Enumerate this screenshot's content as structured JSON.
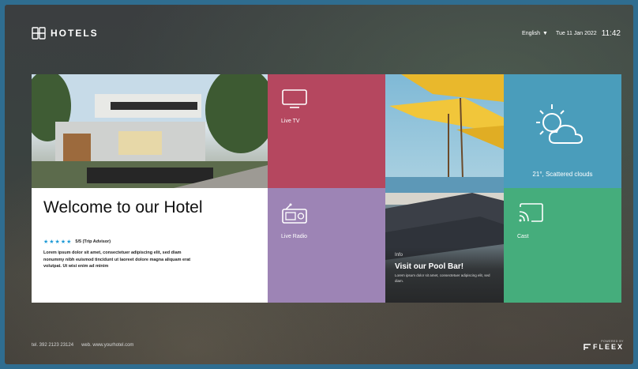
{
  "header": {
    "logo_text": "HOTELS",
    "language": "English",
    "date": "Tue 11 Jan 2022",
    "time": "11:42"
  },
  "welcome": {
    "title": "Welcome to our Hotel",
    "stars": "★★★★★",
    "rating": "5/5 (Trip Advisor)",
    "body": "Lorem ipsum dolor sit amet, consectetuer adipiscing elit, sed diam nonummy nibh euismod tincidunt ut laoreet dolore magna aliquam erat volutpat. Ut wisi enim ad minim"
  },
  "tiles": {
    "live_tv": {
      "label": "Live TV",
      "icon": "tv-icon",
      "color": "#b5475f"
    },
    "live_radio": {
      "label": "Live Radio",
      "icon": "radio-icon",
      "color": "#9d84b5"
    },
    "weather": {
      "label": "21°, Scattered clouds",
      "icon": "partly-cloudy-icon",
      "color": "#4a9dbb"
    },
    "cast": {
      "label": "Cast",
      "icon": "cast-icon",
      "color": "#45ad7c"
    },
    "pool": {
      "tag": "Info",
      "title": "Visit our Pool Bar!",
      "text": "Lorem ipsum dolor sit amet, consectetuer adipiscing elit, sed diam."
    }
  },
  "footer": {
    "tel": "tel. 392 2123 23124",
    "web": "web. www.yourhotel.com"
  },
  "brand": {
    "powered_by": "POWERED BY",
    "name": "FLEEX"
  }
}
